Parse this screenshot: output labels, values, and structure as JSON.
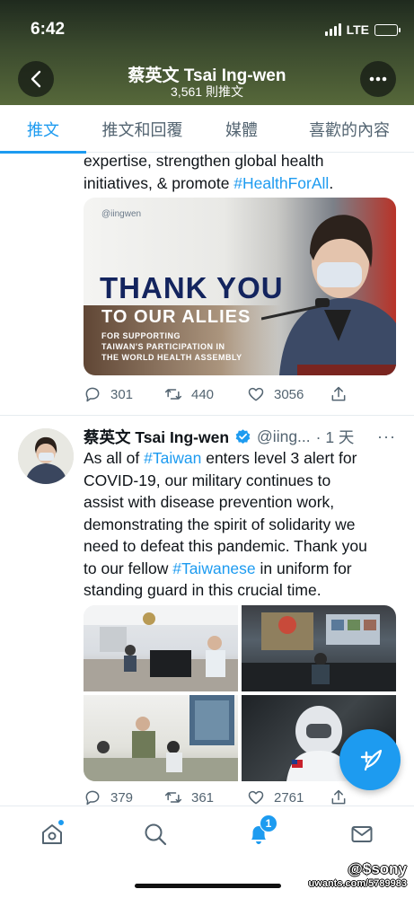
{
  "status_bar": {
    "time": "6:42",
    "network": "LTE"
  },
  "header": {
    "name": "蔡英文 Tsai Ing-wen",
    "tweet_count": "3,561 則推文"
  },
  "tabs": [
    {
      "label": "推文",
      "active": true
    },
    {
      "label": "推文和回覆",
      "active": false
    },
    {
      "label": "媒體",
      "active": false
    },
    {
      "label": "喜歡的內容",
      "active": false
    }
  ],
  "tweet1": {
    "text_lines": [
      {
        "parts": [
          {
            "t": "expertise, strengthen global health",
            "tag": false
          }
        ]
      },
      {
        "parts": [
          {
            "t": "initiatives, & promote ",
            "tag": false
          },
          {
            "t": "#HealthForAll",
            "tag": true
          },
          {
            "t": ".",
            "tag": false
          }
        ]
      }
    ],
    "image": {
      "handle": "@iingwen",
      "headline": "THANK YOU",
      "subheadline": "TO OUR ALLIES",
      "small_lines": [
        "FOR SUPPORTING",
        "TAIWAN'S PARTICIPATION IN",
        "THE WORLD HEALTH ASSEMBLY"
      ]
    },
    "stats": {
      "replies": "301",
      "retweets": "440",
      "likes": "3056"
    }
  },
  "tweet2": {
    "author": "蔡英文 Tsai Ing-wen",
    "handle": "@iing...",
    "time": "· 1 天",
    "more": "···",
    "text_lines": [
      {
        "parts": [
          {
            "t": "As all of ",
            "tag": false
          },
          {
            "t": "#Taiwan",
            "tag": true
          },
          {
            "t": " enters level 3 alert for",
            "tag": false
          }
        ]
      },
      {
        "parts": [
          {
            "t": "COVID-19, our military continues to",
            "tag": false
          }
        ]
      },
      {
        "parts": [
          {
            "t": "assist with disease prevention work,",
            "tag": false
          }
        ]
      },
      {
        "parts": [
          {
            "t": "demonstrating the spirit of solidarity we",
            "tag": false
          }
        ]
      },
      {
        "parts": [
          {
            "t": "need to defeat this pandemic. Thank you",
            "tag": false
          }
        ]
      },
      {
        "parts": [
          {
            "t": "to our fellow ",
            "tag": false
          },
          {
            "t": "#Taiwanese",
            "tag": true
          },
          {
            "t": " in uniform for",
            "tag": false
          }
        ]
      },
      {
        "parts": [
          {
            "t": "standing guard in this crucial time.",
            "tag": false
          }
        ]
      }
    ],
    "stats": {
      "replies": "379",
      "retweets": "361",
      "likes": "2761"
    }
  },
  "bottom_nav": {
    "notification_count": "1"
  },
  "watermark": {
    "line1": "@$sony",
    "line2": "uwants.com/5789983"
  },
  "colors": {
    "accent": "#1d9bf0",
    "text": "#0f1419",
    "muted": "#536471"
  },
  "icons": [
    "back-arrow-icon",
    "more-icon",
    "reply-icon",
    "retweet-icon",
    "like-icon",
    "share-icon",
    "verified-icon",
    "compose-icon",
    "home-icon",
    "search-icon",
    "notifications-icon",
    "messages-icon"
  ]
}
